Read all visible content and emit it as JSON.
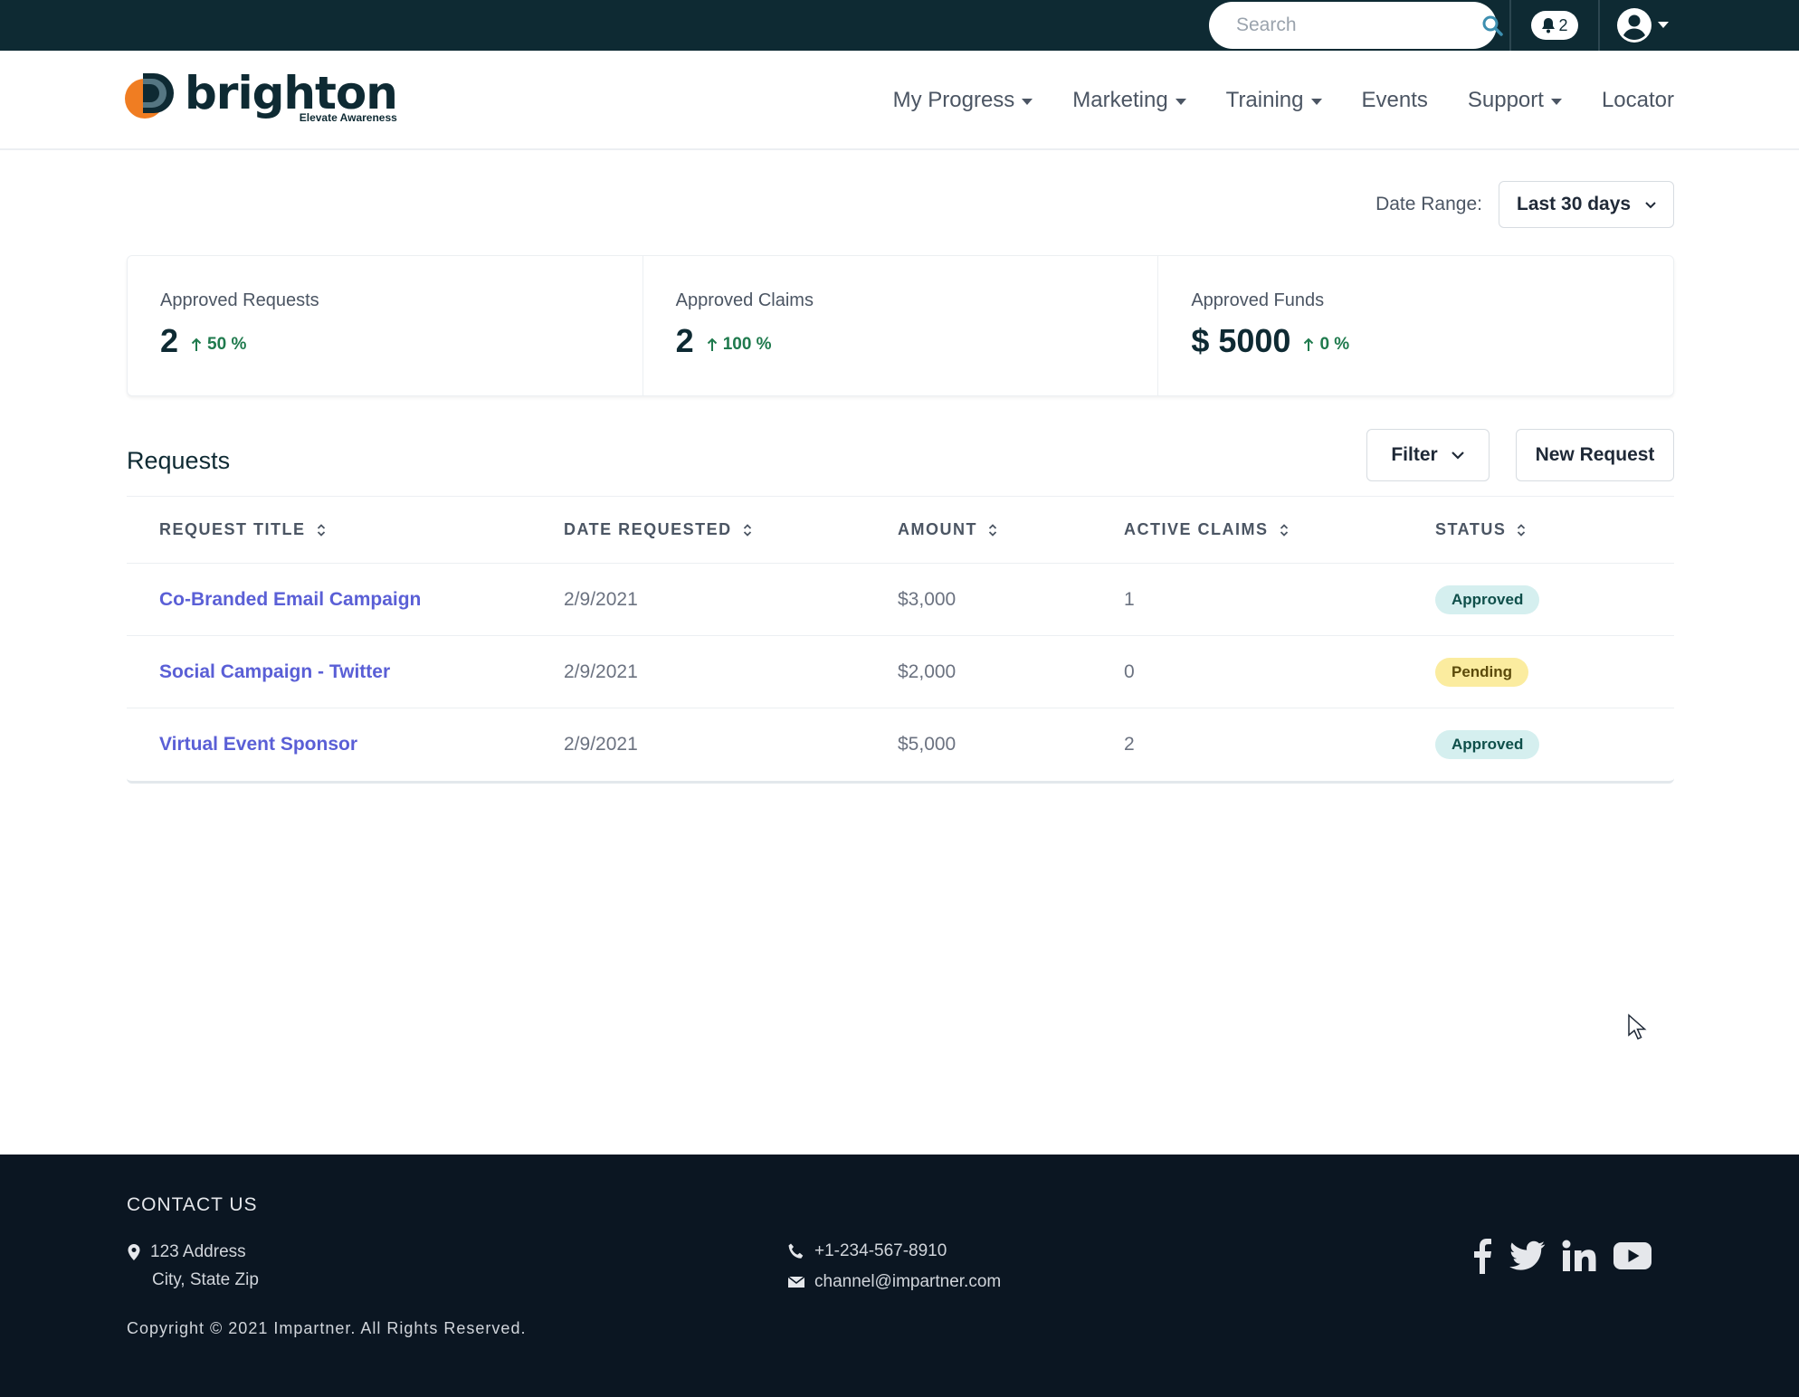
{
  "topbar": {
    "search_placeholder": "Search",
    "notification_count": "2"
  },
  "header": {
    "logo_name": "brighton",
    "logo_tagline": "Elevate Awareness",
    "nav": [
      {
        "label": "My Progress",
        "dropdown": true
      },
      {
        "label": "Marketing",
        "dropdown": true
      },
      {
        "label": "Training",
        "dropdown": true
      },
      {
        "label": "Events",
        "dropdown": false
      },
      {
        "label": "Support",
        "dropdown": true
      },
      {
        "label": "Locator",
        "dropdown": false
      }
    ]
  },
  "date_range": {
    "label": "Date Range:",
    "value": "Last 30 days"
  },
  "stats": [
    {
      "label": "Approved Requests",
      "value": "2",
      "change": "50 %"
    },
    {
      "label": "Approved Claims",
      "value": "2",
      "change": "100 %"
    },
    {
      "label": "Approved Funds",
      "value": "$ 5000",
      "change": "0 %"
    }
  ],
  "requests": {
    "title": "Requests",
    "filter_label": "Filter",
    "new_request_label": "New Request",
    "columns": [
      "REQUEST TITLE",
      "DATE REQUESTED",
      "AMOUNT",
      "ACTIVE CLAIMS",
      "STATUS"
    ],
    "rows": [
      {
        "title": "Co-Branded Email Campaign",
        "date": "2/9/2021",
        "amount": "$3,000",
        "claims": "1",
        "status": "Approved"
      },
      {
        "title": "Social Campaign - Twitter",
        "date": "2/9/2021",
        "amount": "$2,000",
        "claims": "0",
        "status": "Pending"
      },
      {
        "title": "Virtual Event Sponsor",
        "date": "2/9/2021",
        "amount": "$5,000",
        "claims": "2",
        "status": "Approved"
      }
    ]
  },
  "footer": {
    "contact_title": "CONTACT US",
    "address_line1": "123 Address",
    "address_line2": "City, State Zip",
    "phone": "+1-234-567-8910",
    "email": "channel@impartner.com",
    "copyright": "Copyright © 2021 Impartner. All Rights Reserved.",
    "social": [
      "facebook-icon",
      "twitter-icon",
      "linkedin-icon",
      "youtube-icon"
    ]
  },
  "colors": {
    "topbar_bg": "#0e2a33",
    "accent_link": "#5a5fd6",
    "positive": "#1f7a4d",
    "approved_bg": "#d5efef",
    "pending_bg": "#fbec9f",
    "footer_bg": "#0b1622",
    "logo_orange": "#f07d22"
  }
}
